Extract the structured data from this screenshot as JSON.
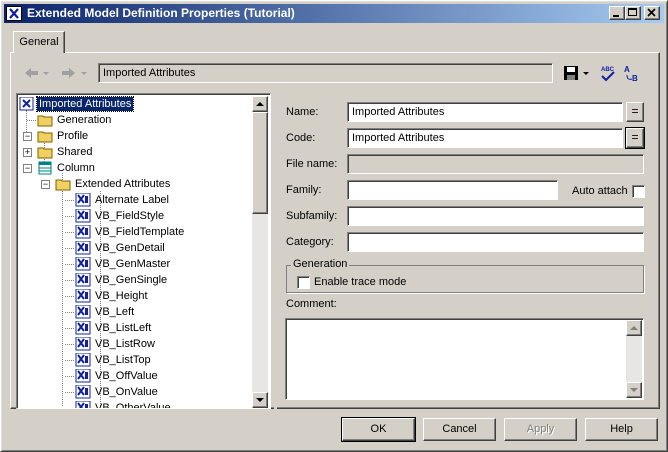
{
  "window": {
    "title": "Extended Model Definition Properties (Tutorial)"
  },
  "tabs": [
    {
      "label": "General",
      "active": true
    }
  ],
  "toolbar": {
    "path_value": "Imported Attributes",
    "icons": [
      "back-arrow-icon",
      "forward-arrow-icon",
      "save-icon",
      "spell-check-icon",
      "find-replace-icon"
    ]
  },
  "tree": {
    "items": [
      {
        "label": "Imported Attributes",
        "icon": "extended-model-icon",
        "selected": true
      },
      {
        "label": "Generation",
        "icon": "folder-icon"
      },
      {
        "label": "Profile",
        "icon": "folder-icon",
        "expanded": true
      },
      {
        "label": "Shared",
        "icon": "folder-icon",
        "expanded": false
      },
      {
        "label": "Column",
        "icon": "column-icon",
        "expanded": true
      },
      {
        "label": "Extended Attributes",
        "icon": "folder-icon",
        "expanded": true
      },
      {
        "label": "Alternate Label",
        "icon": "extended-attribute-icon"
      },
      {
        "label": "VB_FieldStyle",
        "icon": "extended-attribute-icon"
      },
      {
        "label": "VB_FieldTemplate",
        "icon": "extended-attribute-icon"
      },
      {
        "label": "VB_GenDetail",
        "icon": "extended-attribute-icon"
      },
      {
        "label": "VB_GenMaster",
        "icon": "extended-attribute-icon"
      },
      {
        "label": "VB_GenSingle",
        "icon": "extended-attribute-icon"
      },
      {
        "label": "VB_Height",
        "icon": "extended-attribute-icon"
      },
      {
        "label": "VB_Left",
        "icon": "extended-attribute-icon"
      },
      {
        "label": "VB_ListLeft",
        "icon": "extended-attribute-icon"
      },
      {
        "label": "VB_ListRow",
        "icon": "extended-attribute-icon"
      },
      {
        "label": "VB_ListTop",
        "icon": "extended-attribute-icon"
      },
      {
        "label": "VB_OffValue",
        "icon": "extended-attribute-icon"
      },
      {
        "label": "VB_OnValue",
        "icon": "extended-attribute-icon"
      },
      {
        "label": "VB_OtherValue",
        "icon": "extended-attribute-icon"
      }
    ]
  },
  "form": {
    "name_label": "Name:",
    "name_value": "Imported Attributes",
    "code_label": "Code:",
    "code_value": "Imported Attributes",
    "eq_label": "=",
    "filename_label": "File name:",
    "filename_value": "",
    "family_label": "Family:",
    "family_value": "",
    "auto_attach_label": "Auto attach",
    "auto_attach_checked": false,
    "subfamily_label": "Subfamily:",
    "subfamily_value": "",
    "category_label": "Category:",
    "category_value": "",
    "generation_group_label": "Generation",
    "trace_mode_label": "Enable trace mode",
    "trace_mode_checked": false,
    "comment_label": "Comment:",
    "comment_value": ""
  },
  "buttons": {
    "ok": "OK",
    "cancel": "Cancel",
    "apply": "Apply",
    "help": "Help"
  },
  "colors": {
    "titlebar_start": "#0a246a",
    "titlebar_end": "#a6caf0",
    "selection": "#0a246a",
    "face": "#d4d0c8",
    "folder": "#f0d060"
  }
}
